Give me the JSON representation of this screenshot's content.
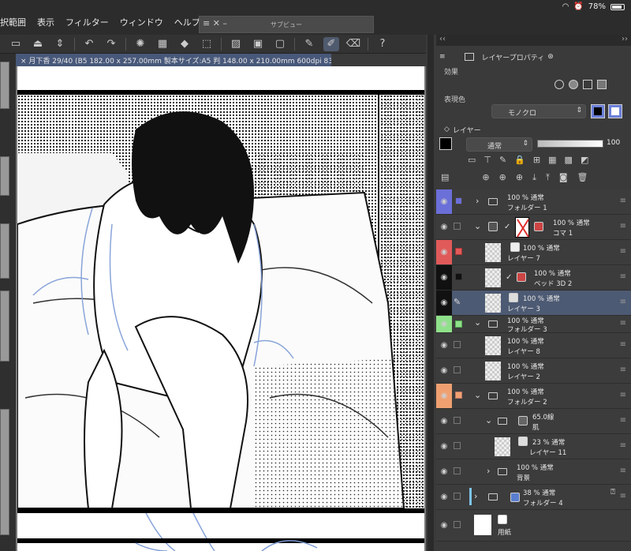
{
  "status": {
    "battery": "78%"
  },
  "menu": [
    "択範囲",
    "表示",
    "フィルター",
    "ウィンドウ",
    "ヘルプ"
  ],
  "subview": {
    "title": "サブビュー"
  },
  "file_tab": "× 月下香 29/40 (B5 182.00 x 257.00mm 製本サイズ:A5 判 148.00 x 210.00mm 600dpi 83.2%)",
  "properties": {
    "tab_label": "レイヤープロパティ",
    "effect_label": "効果",
    "color_label": "表現色",
    "color_value": "モノクロ"
  },
  "layers_panel": {
    "tab_label": "レイヤー",
    "blend_mode": "通常",
    "opacity": "100"
  },
  "layers": [
    {
      "line1": "100 % 通常",
      "line2": "フォルダー 1",
      "color": "#6b6fd8"
    },
    {
      "line1": "100 % 通常",
      "line2": "コマ 1",
      "color": ""
    },
    {
      "line1": "100 % 通常",
      "line2": "レイヤー 7",
      "color": "#e05a5a"
    },
    {
      "line1": "100 % 通常",
      "line2": "ベッド 3D 2",
      "color": "#111111"
    },
    {
      "line1": "100 % 通常",
      "line2": "レイヤー 3",
      "color": "#111111"
    },
    {
      "line1": "100 % 通常",
      "line2": "フォルダー 3",
      "color": "#8fe08a"
    },
    {
      "line1": "100 % 通常",
      "line2": "レイヤー 8",
      "color": ""
    },
    {
      "line1": "100 % 通常",
      "line2": "レイヤー 2",
      "color": ""
    },
    {
      "line1": "100 % 通常",
      "line2": "フォルダー 2",
      "color": "#f0a070"
    },
    {
      "line1": "65.0線",
      "line2": "肌",
      "color": ""
    },
    {
      "line1": "23 % 通常",
      "line2": "レイヤー 11",
      "color": ""
    },
    {
      "line1": "100 % 通常",
      "line2": "背景",
      "color": ""
    },
    {
      "line1": "38 % 通常",
      "line2": "フォルダー 4",
      "color": ""
    },
    {
      "line1": "",
      "line2": "用紙",
      "color": ""
    }
  ],
  "icons": [
    "wifi-icon",
    "battery-icon",
    "undo-icon",
    "redo-icon",
    "eye-icon",
    "folder-icon",
    "lock-icon",
    "pen-icon"
  ]
}
